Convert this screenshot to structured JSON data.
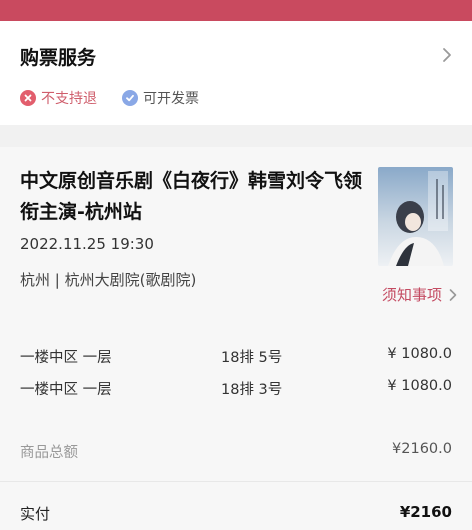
{
  "service": {
    "title": "购票服务",
    "tags": [
      {
        "label": "不支持退",
        "icon": "x-circle-icon",
        "color": "#e25e6d"
      },
      {
        "label": "可开发票",
        "icon": "check-circle-icon",
        "color": "#8aa8e6"
      }
    ]
  },
  "show": {
    "title": "中文原创音乐剧《白夜行》韩雪刘令飞领衔主演-杭州站",
    "datetime": "2022.11.25 19:30",
    "venue": "杭州 | 杭州大剧院(歌剧院)",
    "notice_label": "须知事项"
  },
  "tickets": [
    {
      "area": "一楼中区 一层",
      "seat": "18排 5号",
      "price": "¥ 1080.0"
    },
    {
      "area": "一楼中区 一层",
      "seat": "18排 3号",
      "price": "¥ 1080.0"
    }
  ],
  "summary": {
    "subtotal_label": "商品总额",
    "subtotal_value": "¥2160.0",
    "paid_label": "实付",
    "paid_value": "¥2160"
  },
  "colors": {
    "brand": "#c94a5f",
    "notice": "#c44b62"
  }
}
